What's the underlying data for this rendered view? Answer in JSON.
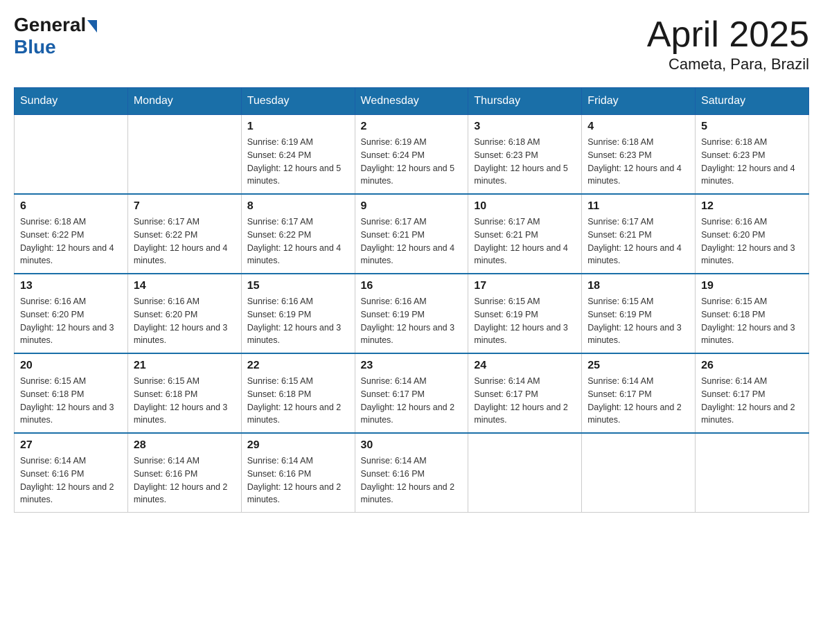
{
  "header": {
    "logo_general": "General",
    "logo_blue": "Blue",
    "title": "April 2025",
    "subtitle": "Cameta, Para, Brazil"
  },
  "days_of_week": [
    "Sunday",
    "Monday",
    "Tuesday",
    "Wednesday",
    "Thursday",
    "Friday",
    "Saturday"
  ],
  "weeks": [
    [
      {
        "day": "",
        "info": ""
      },
      {
        "day": "",
        "info": ""
      },
      {
        "day": "1",
        "info": "Sunrise: 6:19 AM\nSunset: 6:24 PM\nDaylight: 12 hours and 5 minutes."
      },
      {
        "day": "2",
        "info": "Sunrise: 6:19 AM\nSunset: 6:24 PM\nDaylight: 12 hours and 5 minutes."
      },
      {
        "day": "3",
        "info": "Sunrise: 6:18 AM\nSunset: 6:23 PM\nDaylight: 12 hours and 5 minutes."
      },
      {
        "day": "4",
        "info": "Sunrise: 6:18 AM\nSunset: 6:23 PM\nDaylight: 12 hours and 4 minutes."
      },
      {
        "day": "5",
        "info": "Sunrise: 6:18 AM\nSunset: 6:23 PM\nDaylight: 12 hours and 4 minutes."
      }
    ],
    [
      {
        "day": "6",
        "info": "Sunrise: 6:18 AM\nSunset: 6:22 PM\nDaylight: 12 hours and 4 minutes."
      },
      {
        "day": "7",
        "info": "Sunrise: 6:17 AM\nSunset: 6:22 PM\nDaylight: 12 hours and 4 minutes."
      },
      {
        "day": "8",
        "info": "Sunrise: 6:17 AM\nSunset: 6:22 PM\nDaylight: 12 hours and 4 minutes."
      },
      {
        "day": "9",
        "info": "Sunrise: 6:17 AM\nSunset: 6:21 PM\nDaylight: 12 hours and 4 minutes."
      },
      {
        "day": "10",
        "info": "Sunrise: 6:17 AM\nSunset: 6:21 PM\nDaylight: 12 hours and 4 minutes."
      },
      {
        "day": "11",
        "info": "Sunrise: 6:17 AM\nSunset: 6:21 PM\nDaylight: 12 hours and 4 minutes."
      },
      {
        "day": "12",
        "info": "Sunrise: 6:16 AM\nSunset: 6:20 PM\nDaylight: 12 hours and 3 minutes."
      }
    ],
    [
      {
        "day": "13",
        "info": "Sunrise: 6:16 AM\nSunset: 6:20 PM\nDaylight: 12 hours and 3 minutes."
      },
      {
        "day": "14",
        "info": "Sunrise: 6:16 AM\nSunset: 6:20 PM\nDaylight: 12 hours and 3 minutes."
      },
      {
        "day": "15",
        "info": "Sunrise: 6:16 AM\nSunset: 6:19 PM\nDaylight: 12 hours and 3 minutes."
      },
      {
        "day": "16",
        "info": "Sunrise: 6:16 AM\nSunset: 6:19 PM\nDaylight: 12 hours and 3 minutes."
      },
      {
        "day": "17",
        "info": "Sunrise: 6:15 AM\nSunset: 6:19 PM\nDaylight: 12 hours and 3 minutes."
      },
      {
        "day": "18",
        "info": "Sunrise: 6:15 AM\nSunset: 6:19 PM\nDaylight: 12 hours and 3 minutes."
      },
      {
        "day": "19",
        "info": "Sunrise: 6:15 AM\nSunset: 6:18 PM\nDaylight: 12 hours and 3 minutes."
      }
    ],
    [
      {
        "day": "20",
        "info": "Sunrise: 6:15 AM\nSunset: 6:18 PM\nDaylight: 12 hours and 3 minutes."
      },
      {
        "day": "21",
        "info": "Sunrise: 6:15 AM\nSunset: 6:18 PM\nDaylight: 12 hours and 3 minutes."
      },
      {
        "day": "22",
        "info": "Sunrise: 6:15 AM\nSunset: 6:18 PM\nDaylight: 12 hours and 2 minutes."
      },
      {
        "day": "23",
        "info": "Sunrise: 6:14 AM\nSunset: 6:17 PM\nDaylight: 12 hours and 2 minutes."
      },
      {
        "day": "24",
        "info": "Sunrise: 6:14 AM\nSunset: 6:17 PM\nDaylight: 12 hours and 2 minutes."
      },
      {
        "day": "25",
        "info": "Sunrise: 6:14 AM\nSunset: 6:17 PM\nDaylight: 12 hours and 2 minutes."
      },
      {
        "day": "26",
        "info": "Sunrise: 6:14 AM\nSunset: 6:17 PM\nDaylight: 12 hours and 2 minutes."
      }
    ],
    [
      {
        "day": "27",
        "info": "Sunrise: 6:14 AM\nSunset: 6:16 PM\nDaylight: 12 hours and 2 minutes."
      },
      {
        "day": "28",
        "info": "Sunrise: 6:14 AM\nSunset: 6:16 PM\nDaylight: 12 hours and 2 minutes."
      },
      {
        "day": "29",
        "info": "Sunrise: 6:14 AM\nSunset: 6:16 PM\nDaylight: 12 hours and 2 minutes."
      },
      {
        "day": "30",
        "info": "Sunrise: 6:14 AM\nSunset: 6:16 PM\nDaylight: 12 hours and 2 minutes."
      },
      {
        "day": "",
        "info": ""
      },
      {
        "day": "",
        "info": ""
      },
      {
        "day": "",
        "info": ""
      }
    ]
  ]
}
